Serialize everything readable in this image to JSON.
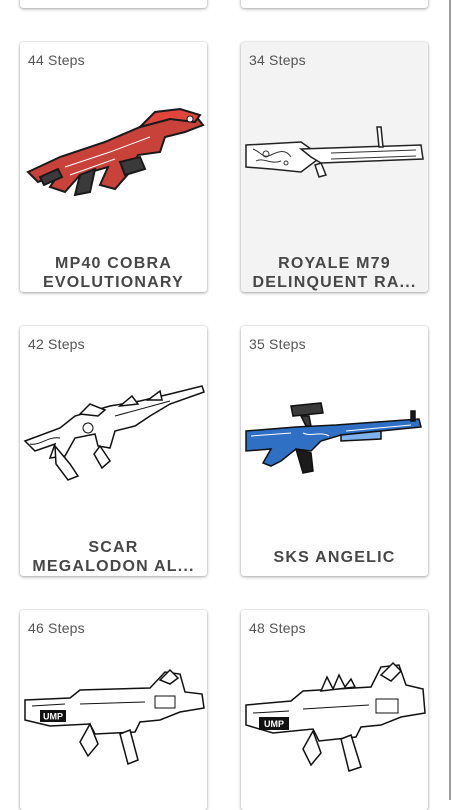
{
  "cards": [
    {
      "steps": "44 Steps",
      "title_line1": "MP40 COBRA",
      "title_line2": "EVOLUTIONARY",
      "image": "mp40-cobra-gun-image"
    },
    {
      "steps": "34 Steps",
      "title_line1": "ROYALE M79",
      "title_line2": "DELINQUENT RA...",
      "image": "royale-m79-gun-image"
    },
    {
      "steps": "42 Steps",
      "title_line1": "SCAR",
      "title_line2": "MEGALODON AL...",
      "image": "scar-megalodon-gun-image"
    },
    {
      "steps": "35 Steps",
      "title_line1": "SKS ANGELIC",
      "title_line2": "",
      "image": "sks-angelic-gun-image"
    },
    {
      "steps": "46 Steps",
      "image": "ump-gun-image"
    },
    {
      "steps": "48 Steps",
      "image": "ump-spiked-gun-image"
    }
  ],
  "gun_labels": {
    "ump": "UMP"
  },
  "colors": {
    "accent_red": "#e0463c",
    "accent_blue": "#2f6fc4",
    "text": "#474747"
  }
}
